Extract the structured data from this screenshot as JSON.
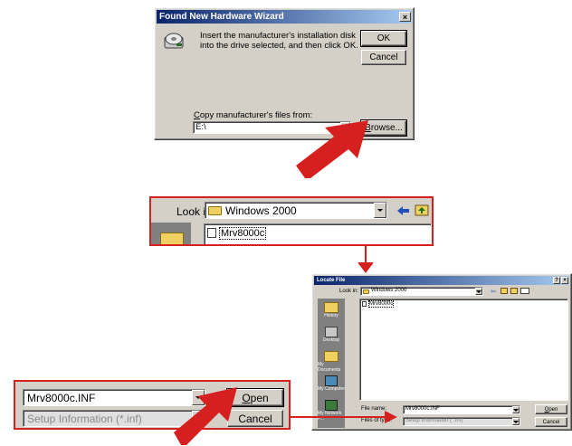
{
  "wizard": {
    "title": "Found New Hardware Wizard",
    "close_glyph": "×",
    "message": "Insert the manufacturer's installation disk into the drive selected, and then click OK.",
    "ok_label": "OK",
    "cancel_label": "Cancel",
    "copy_label": "Copy manufacturer's files from:",
    "path_value": "E:\\",
    "browse_label": "Browse..."
  },
  "lookin_zoom": {
    "label": "Look in:",
    "folder": "Windows 2000",
    "file_item": "Mrv8000c"
  },
  "locate": {
    "title": "Locate File",
    "help_glyph": "?",
    "close_glyph": "×",
    "lookin_label": "Look in:",
    "folder": "Windows 2000",
    "file_item": "Mrv8000c",
    "sidebar": [
      {
        "label": "History",
        "icon": "history-icon"
      },
      {
        "label": "Desktop",
        "icon": "desktop-icon"
      },
      {
        "label": "My Documents",
        "icon": "my-documents-icon"
      },
      {
        "label": "My Computer",
        "icon": "my-computer-icon"
      },
      {
        "label": "My Network P...",
        "icon": "network-icon"
      }
    ],
    "filename_label": "File name:",
    "filename_value": "Mrv8000c.INF",
    "filetype_label": "Files of type:",
    "filetype_value": "Setup Information (*.inf)",
    "open_label": "Open",
    "cancel_label": "Cancel"
  },
  "bottom_zoom": {
    "filename_value": "Mrv8000c.INF",
    "filetype_value": "Setup Information (*.inf)",
    "open_label": "Open",
    "cancel_label": "Cancel"
  },
  "colors": {
    "highlight": "#d62020",
    "dialog": "#d4d0c8",
    "titlebar": "#0a246a"
  }
}
